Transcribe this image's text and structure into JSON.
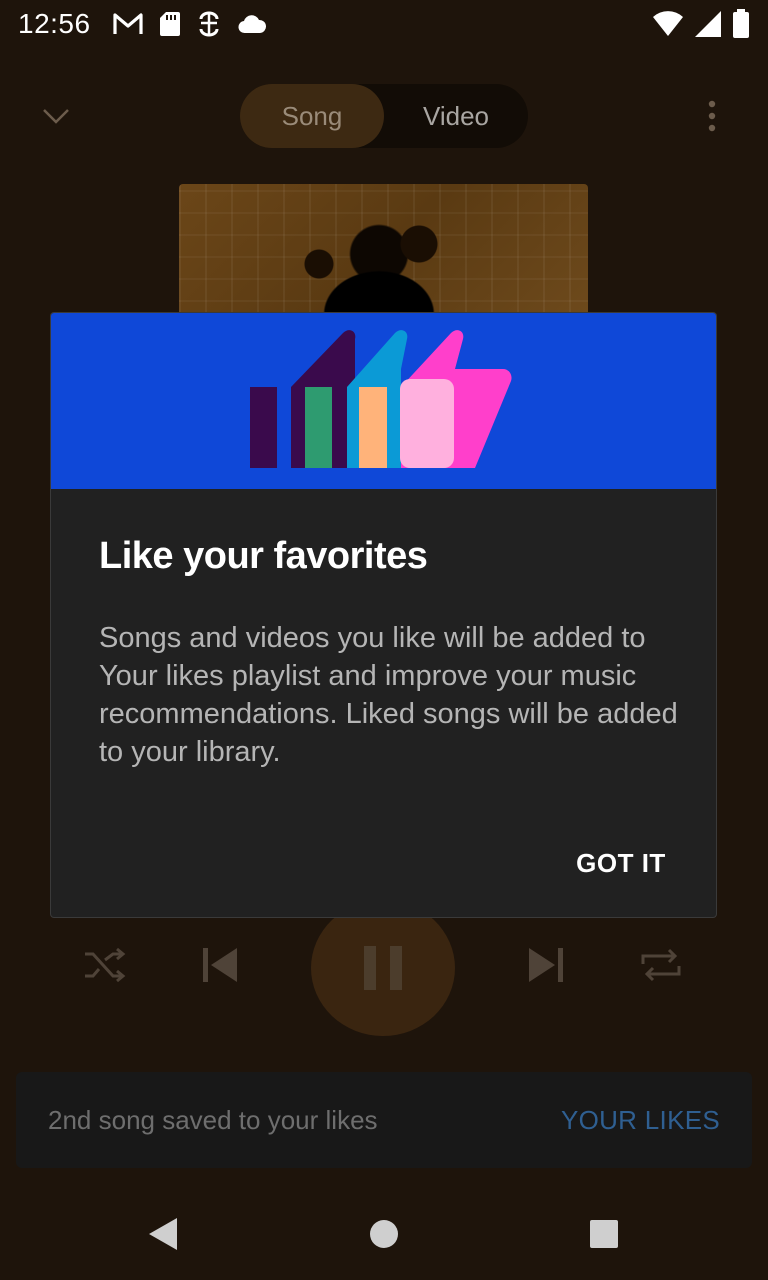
{
  "status_bar": {
    "time": "12:56",
    "left_icons": [
      "gmail-icon",
      "sd-card-icon",
      "sync-icon",
      "cloud-icon"
    ],
    "right_icons": [
      "wifi-icon",
      "cell-signal-icon",
      "battery-icon"
    ]
  },
  "player": {
    "toggle": {
      "song_label": "Song",
      "video_label": "Video",
      "selected": "Song"
    }
  },
  "dialog": {
    "title": "Like your favorites",
    "body": "Songs and videos you like will be added to Your likes playlist and improve your music recommendations. Liked songs will be added to your library.",
    "button": "GOT IT",
    "banner_color": "#0f48d8"
  },
  "snackbar": {
    "message": "2nd song saved to your likes",
    "action": "YOUR LIKES"
  },
  "colors": {
    "background": "#1e140b",
    "dialog_bg": "#212121",
    "accent_link": "#2f5f91"
  }
}
